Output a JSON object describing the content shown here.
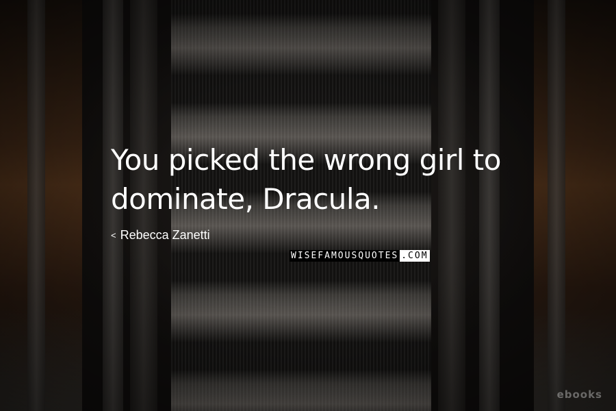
{
  "quote": {
    "line1": "You picked the wrong girl to",
    "line2": "dominate, Dracula."
  },
  "author": {
    "icon": "left-caret-icon",
    "name": "Rebecca Zanetti"
  },
  "brand": {
    "part1": "WISEFAMOUSQUOTES",
    "part2": ".COM"
  },
  "watermark": {
    "text": "ebooks"
  }
}
